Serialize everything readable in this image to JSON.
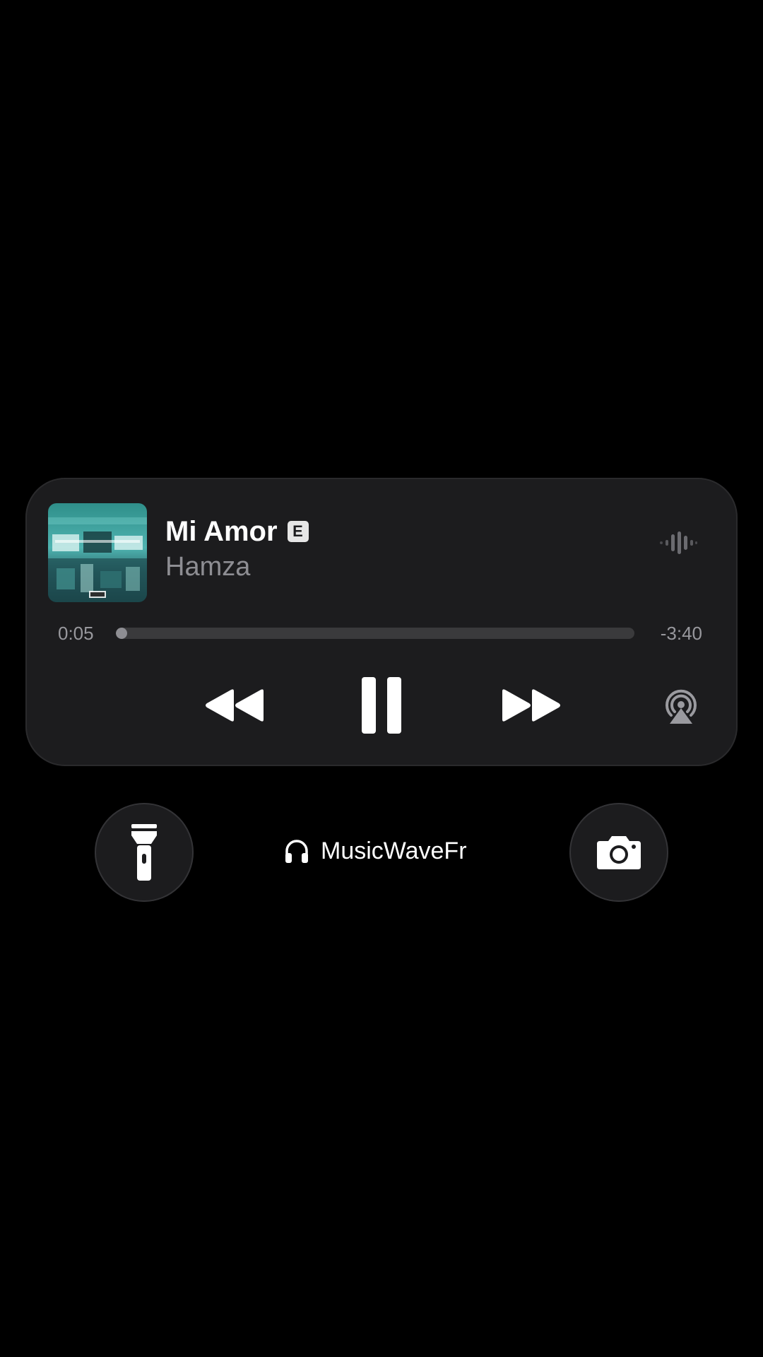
{
  "now_playing": {
    "title": "Mi Amor",
    "explicit_badge": "E",
    "artist": "Hamza",
    "artwork_icon": "album-art",
    "elapsed": "0:05",
    "remaining": "-3:40",
    "progress_fraction": 0.022,
    "controls": {
      "rewind_icon": "rewind-icon",
      "pause_icon": "pause-icon",
      "forward_icon": "fast-forward-icon",
      "airplay_icon": "airplay-audio-icon",
      "waveform_icon": "waveform-icon"
    }
  },
  "bottom_bar": {
    "flashlight_icon": "flashlight-icon",
    "camera_icon": "camera-icon",
    "device_icon": "headphones-icon",
    "device_name": "MusicWaveFr"
  },
  "colors": {
    "background": "#000000",
    "card": "#1c1c1e",
    "secondary_text": "#8e8e93"
  }
}
